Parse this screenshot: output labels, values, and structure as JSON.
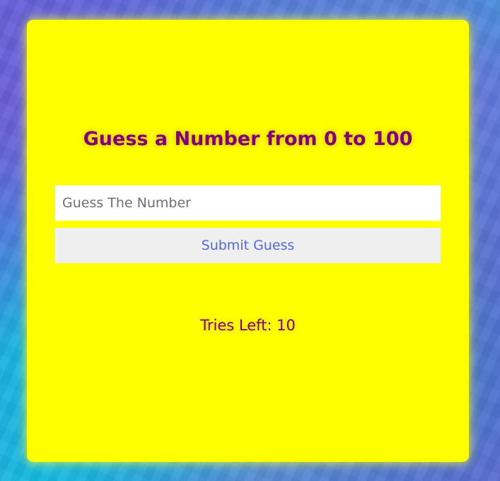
{
  "game": {
    "title": "Guess a Number from 0 to 100",
    "input_placeholder": "Guess The Number",
    "input_value": "",
    "submit_label": "Submit Guess",
    "tries_label": "Tries Left: 10"
  },
  "colors": {
    "card_background": "#ffff00",
    "title_text": "#800080",
    "button_background": "#efefef",
    "button_text": "#4f6bd8",
    "input_background": "#ffffff"
  }
}
